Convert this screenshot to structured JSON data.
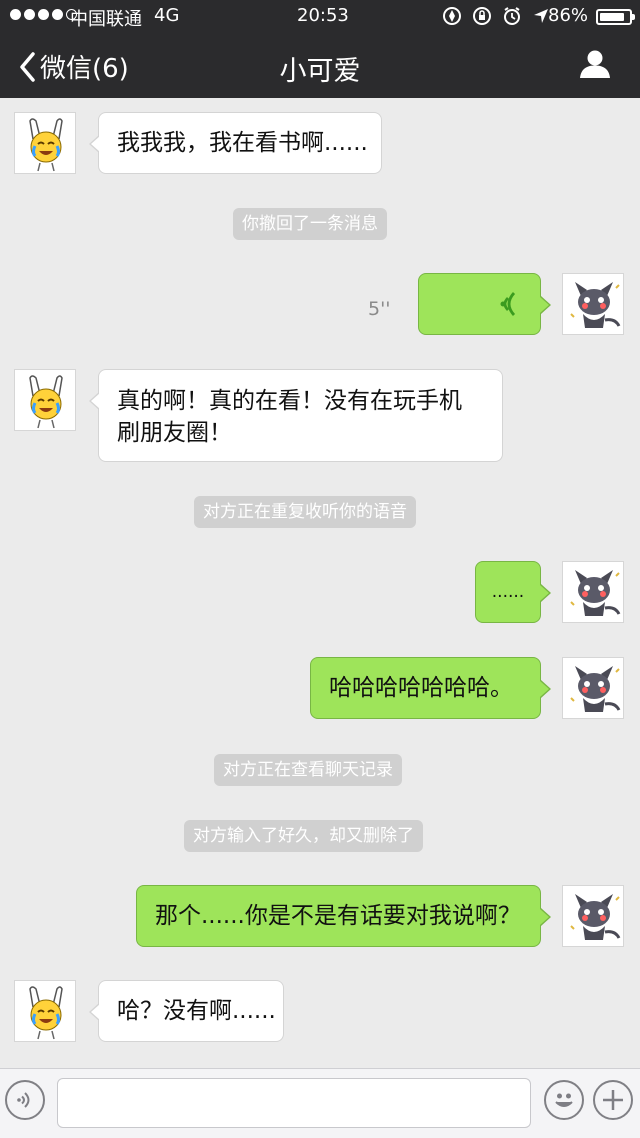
{
  "status": {
    "carrier": "中国联通",
    "network": "4G",
    "time": "20:53",
    "battery": "86%",
    "battery_level": 0.86,
    "signal_bars": 4
  },
  "nav": {
    "back_label": "微信(6)",
    "title": "小可爱"
  },
  "messages": {
    "m1": "我我我，我在看书啊......",
    "sys1": "你撤回了一条消息",
    "voice_duration": "5''",
    "m3_line1": "真的啊！真的在看！没有在玩手机",
    "m3_line2": "刷朋友圈！",
    "sys2": "对方正在重复收听你的语音",
    "m4": "......",
    "m5": "哈哈哈哈哈哈哈。",
    "sys3": "对方正在查看聊天记录",
    "sys4": "对方输入了好久，却又删除了",
    "m6": "那个......你是不是有话要对我说啊？",
    "m7": "哈？没有啊......"
  },
  "input": {
    "value": ""
  },
  "colors": {
    "bar": "#2b2b2d",
    "background": "#ebebeb",
    "bubble_mine": "#9ee45a",
    "bubble_theirs": "#ffffff",
    "system_tip": "#d0d0d0"
  },
  "icons": {
    "back": "chevron-left-icon",
    "profile": "person-icon",
    "voice": "voice-wave-icon",
    "emoji": "smiley-icon",
    "plus": "plus-icon"
  }
}
